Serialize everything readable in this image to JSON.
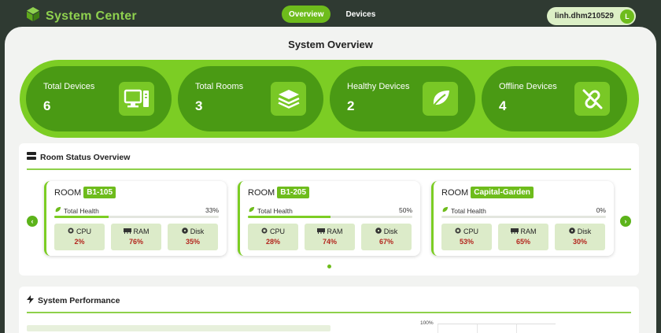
{
  "header": {
    "brand": "System Center",
    "tabs": [
      {
        "label": "Overview",
        "active": true
      },
      {
        "label": "Devices",
        "active": false
      }
    ],
    "user": {
      "name": "linh.dhm210529",
      "initial": "L"
    }
  },
  "page_title": "System Overview",
  "stats": [
    {
      "label": "Total Devices",
      "value": "6",
      "icon": "desktop-icon"
    },
    {
      "label": "Total Rooms",
      "value": "3",
      "icon": "layers-icon"
    },
    {
      "label": "Healthy Devices",
      "value": "2",
      "icon": "leaf-icon"
    },
    {
      "label": "Offline Devices",
      "value": "4",
      "icon": "broken-link-icon"
    }
  ],
  "room_section": {
    "title": "Room Status Overview",
    "room_prefix": "ROOM",
    "health_label": "Total Health",
    "rooms": [
      {
        "name": "B1-105",
        "health": "33%",
        "health_pct": 33,
        "metrics": [
          {
            "name": "CPU",
            "value": "2%"
          },
          {
            "name": "RAM",
            "value": "76%"
          },
          {
            "name": "Disk",
            "value": "35%"
          }
        ]
      },
      {
        "name": "B1-205",
        "health": "50%",
        "health_pct": 50,
        "metrics": [
          {
            "name": "CPU",
            "value": "28%"
          },
          {
            "name": "RAM",
            "value": "74%"
          },
          {
            "name": "Disk",
            "value": "67%"
          }
        ]
      },
      {
        "name": "Capital-Garden",
        "health": "0%",
        "health_pct": 0,
        "metrics": [
          {
            "name": "CPU",
            "value": "53%"
          },
          {
            "name": "RAM",
            "value": "65%"
          },
          {
            "name": "Disk",
            "value": "30%"
          }
        ]
      }
    ]
  },
  "perf_section": {
    "title": "System Performance",
    "axis_top": "100%"
  },
  "colors": {
    "accent": "#6ebc1c",
    "accent_dark": "#4a9a14",
    "alert_text": "#b3261e"
  }
}
